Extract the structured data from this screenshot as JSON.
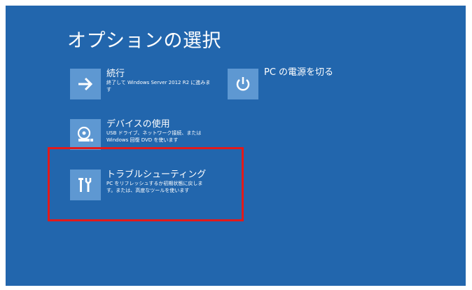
{
  "screen": {
    "title": "オプションの選択",
    "background": "#2266ad",
    "tile_color": "#5e98d2",
    "highlight_color": "#e21a1a"
  },
  "options": [
    {
      "label": "続行",
      "description": "終了して Windows Server 2012 R2 に進みます",
      "icon": "arrow-right-icon"
    },
    {
      "label": "PC の電源を切る",
      "description": "",
      "icon": "power-icon"
    },
    {
      "label": "デバイスの使用",
      "description": "USB ドライブ、ネットワーク接続、または Windows 回復 DVD を使います",
      "icon": "disc-drive-icon"
    },
    {
      "label": "トラブルシューティング",
      "description": "PC をリフレッシュするか初期状態に戻します。または、高度なツールを使います",
      "icon": "tools-icon"
    }
  ]
}
